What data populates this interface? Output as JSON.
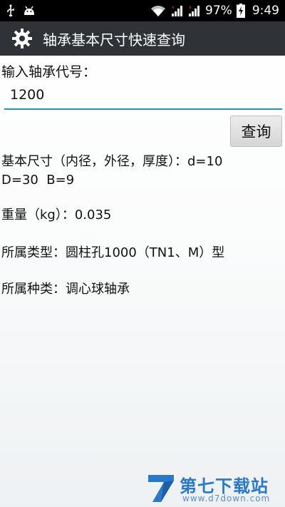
{
  "status_bar": {
    "icons": [
      "usb-icon",
      "android-icon",
      "wifi-icon",
      "signal-icon",
      "signal-icon",
      "battery-icon"
    ],
    "battery": "97%",
    "time": "9:49"
  },
  "app_bar": {
    "title": "轴承基本尺寸快速查询",
    "icon": "gear-icon"
  },
  "form": {
    "input_label": "输入轴承代号：",
    "input_value": "1200",
    "query_button": "查询"
  },
  "results": {
    "size_line1": "基本尺寸（内径，外径，厚度）：d=10",
    "size_line2": "D=30  B=9",
    "weight": "重量（kg）：0.035",
    "type": "所属类型：圆柱孔1000（TN1、M）型",
    "kind": "所属种类：调心球轴承"
  },
  "watermark": {
    "text": "第七下载站",
    "url": "www.d7down.com"
  },
  "colors": {
    "action_bar": "#2f3337",
    "input_underline": "#2e8fb6",
    "watermark": "#2a78c8"
  }
}
